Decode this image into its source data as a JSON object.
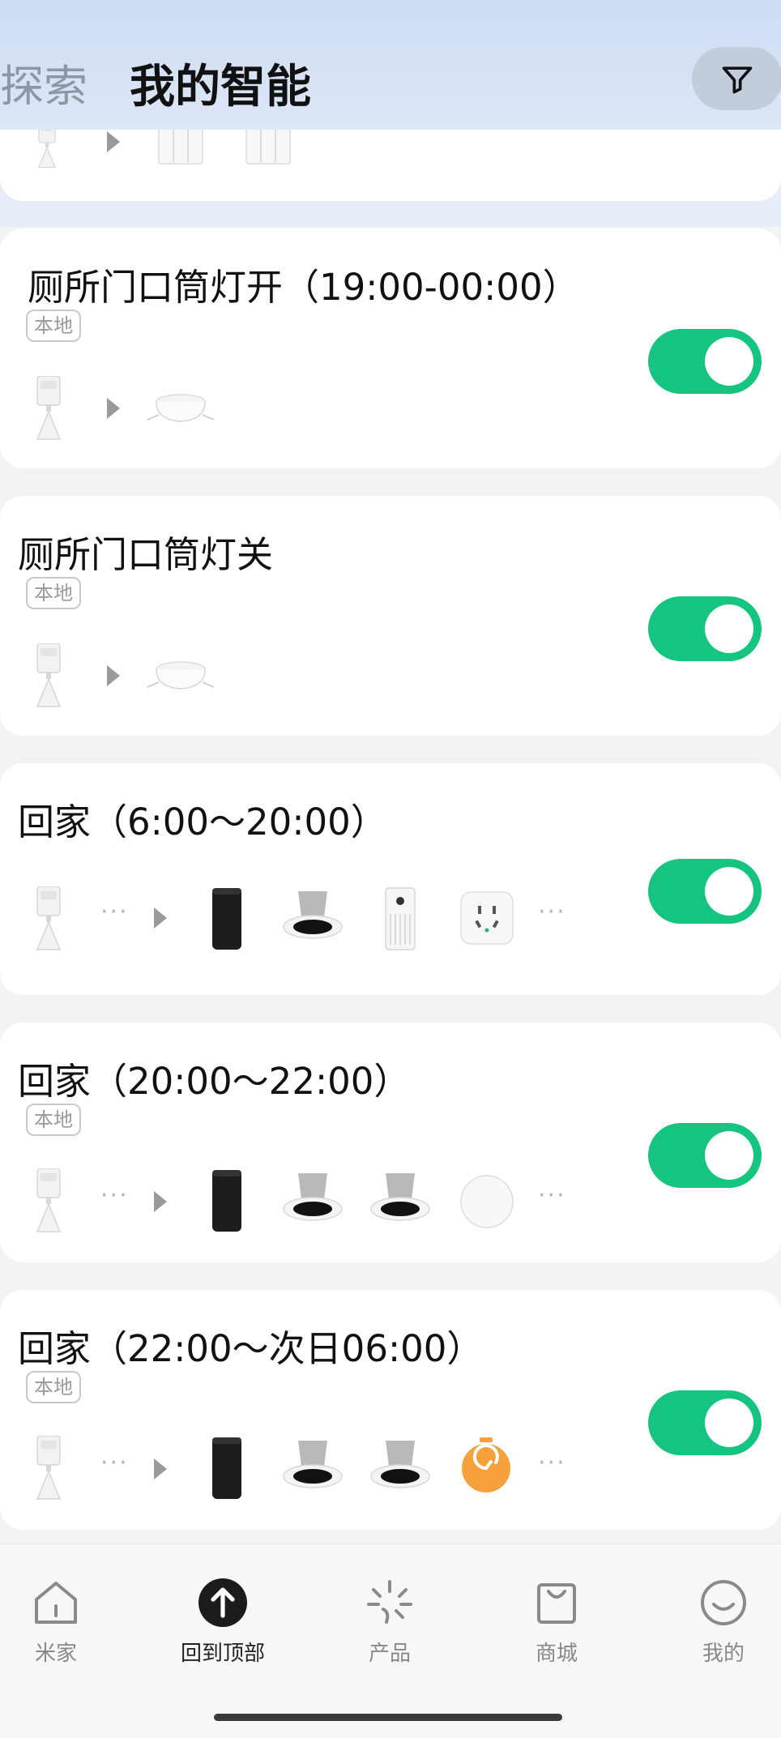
{
  "header": {
    "tab_explore": "探索",
    "tab_mine": "我的智能",
    "filter_icon": "filter-icon"
  },
  "scenes": [
    {
      "title": "厕所门口筒灯开（19:00-00:00）",
      "badge": "本地",
      "enabled": true
    },
    {
      "title": "厕所门口筒灯关",
      "badge": "本地",
      "enabled": true
    },
    {
      "title": "回家（6:00～20:00）",
      "badge": "",
      "enabled": true
    },
    {
      "title": "回家（20:00～22:00）",
      "badge": "本地",
      "enabled": true
    },
    {
      "title": "回家（22:00～次日06:00）",
      "badge": "本地",
      "enabled": true
    }
  ],
  "more_dots": "···",
  "nav": {
    "items": [
      {
        "label": "米家",
        "icon": "house-icon"
      },
      {
        "label": "回到顶部",
        "icon": "arrow-up-icon"
      },
      {
        "label": "产品",
        "icon": "sparkle-icon"
      },
      {
        "label": "商城",
        "icon": "shopping-bag-icon"
      },
      {
        "label": "我的",
        "icon": "smile-icon"
      }
    ]
  },
  "colors": {
    "toggle_on": "#14c47f",
    "header_bg": "#cfdcf3",
    "timer_orange": "#f5a03a"
  }
}
